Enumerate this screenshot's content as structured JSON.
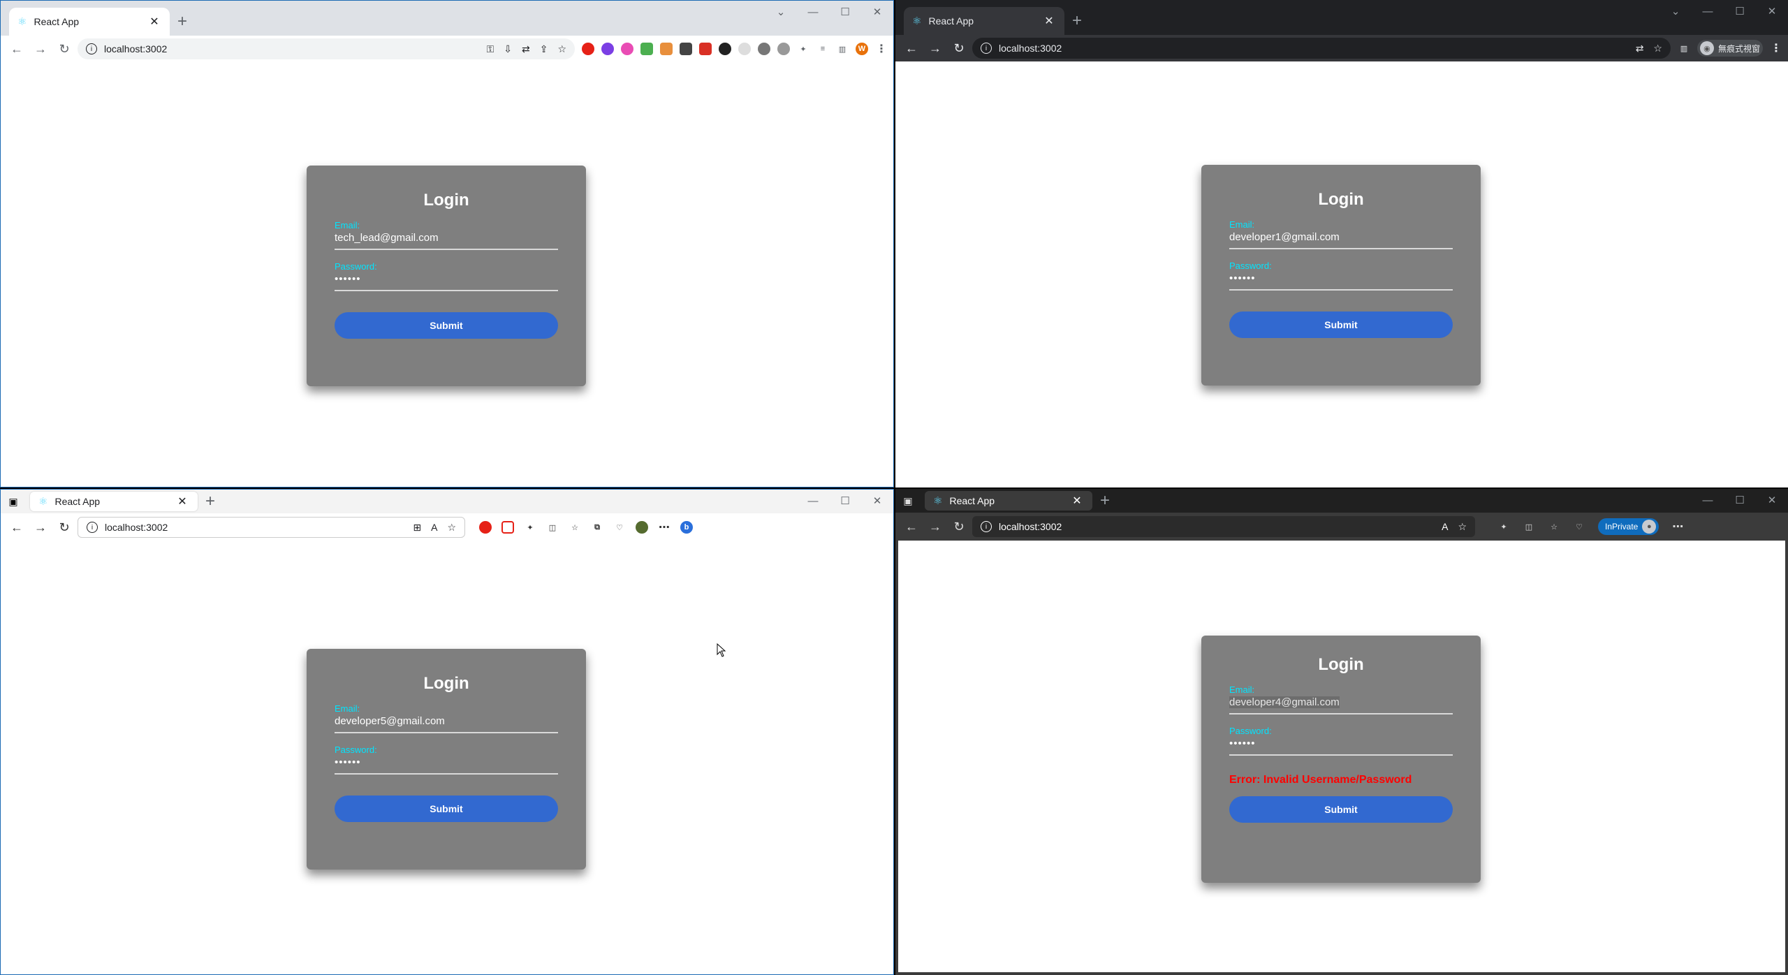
{
  "windows": [
    {
      "tab_title": "React App",
      "url": "localhost:3002",
      "card": {
        "title": "Login",
        "email_label": "Email:",
        "email_value": "tech_lead@gmail.com",
        "password_label": "Password:",
        "password_value": "••••••",
        "submit_label": "Submit"
      }
    },
    {
      "tab_title": "React App",
      "url": "localhost:3002",
      "guest_label": "無痕式視窗",
      "card": {
        "title": "Login",
        "email_label": "Email:",
        "email_value": "developer1@gmail.com",
        "password_label": "Password:",
        "password_value": "••••••",
        "submit_label": "Submit"
      }
    },
    {
      "tab_title": "React App",
      "url": "localhost:3002",
      "card": {
        "title": "Login",
        "email_label": "Email:",
        "email_value": "developer5@gmail.com",
        "password_label": "Password:",
        "password_value": "••••••",
        "submit_label": "Submit"
      }
    },
    {
      "tab_title": "React App",
      "url": "localhost:3002",
      "inprivate_label": "InPrivate",
      "card": {
        "title": "Login",
        "email_label": "Email:",
        "email_value": "developer4@gmail.com",
        "password_label": "Password:",
        "password_value": "••••••",
        "error": "Error: Invalid Username/Password",
        "submit_label": "Submit"
      }
    }
  ],
  "colors": {
    "card_bg": "#7f7f7f",
    "label": "#00e5ff",
    "button": "#3269d0",
    "error": "#ff0000"
  },
  "icons": [
    "back-icon",
    "forward-icon",
    "reload-icon",
    "info-icon",
    "star-icon",
    "minimize-icon",
    "maximize-icon",
    "close-icon",
    "new-tab-icon",
    "react-favicon"
  ]
}
